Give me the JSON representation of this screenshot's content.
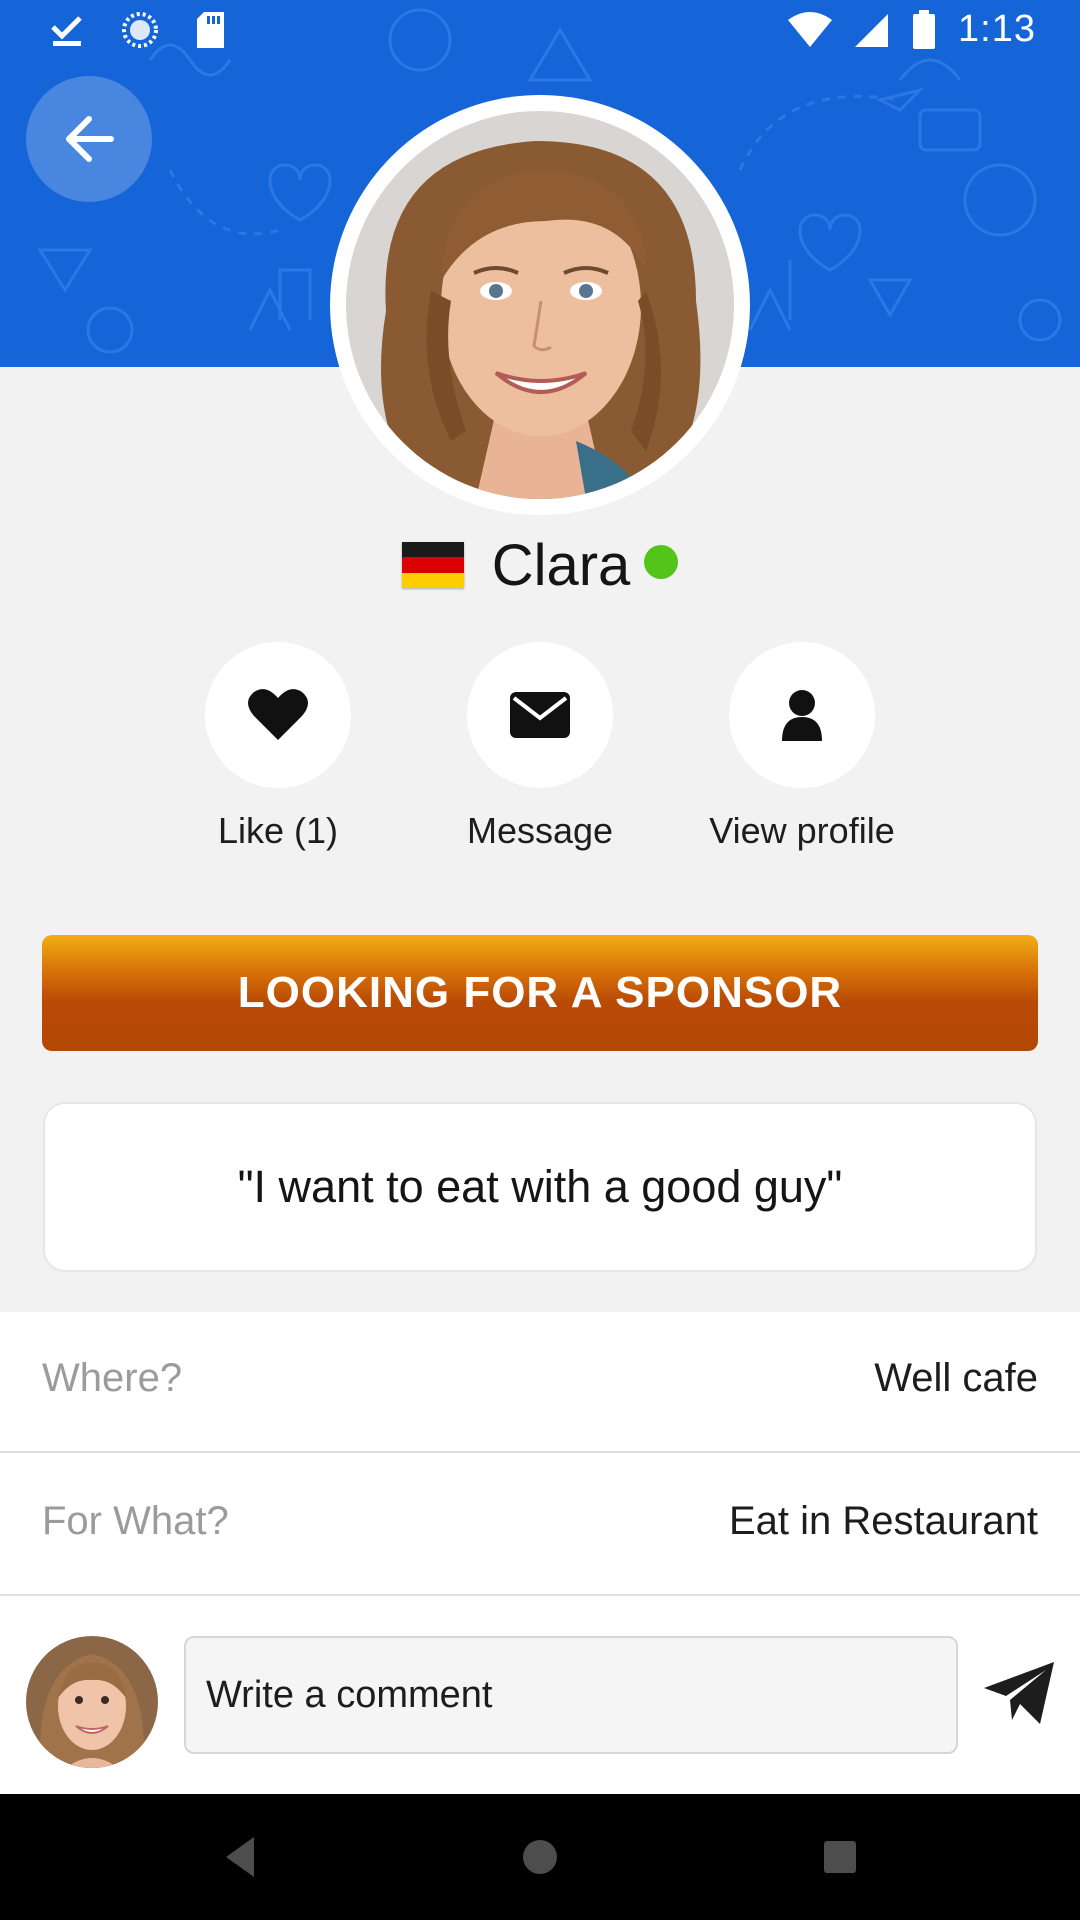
{
  "status_bar": {
    "time": "1:13",
    "icons": [
      "check-download-icon",
      "sync-circle-icon",
      "sd-card-icon",
      "wifi-icon",
      "signal-icon",
      "battery-icon"
    ]
  },
  "header": {
    "back_icon": "arrow-left-icon",
    "background_color": "#1565d8"
  },
  "profile": {
    "name": "Clara",
    "country_flag": "germany-flag-icon",
    "online_color": "#52c41a"
  },
  "actions": [
    {
      "label": "Like (1)",
      "icon": "heart-icon"
    },
    {
      "label": "Message",
      "icon": "envelope-icon"
    },
    {
      "label": "View profile",
      "icon": "user-icon"
    }
  ],
  "sponsor_button": {
    "label": "LOOKING FOR A SPONSOR",
    "color": "#b84a05"
  },
  "quote": "\"I want to eat with a good guy\"",
  "details": [
    {
      "key": "Where?",
      "value": "Well cafe"
    },
    {
      "key": "For What?",
      "value": "Eat in Restaurant"
    }
  ],
  "comment": {
    "placeholder": "Write a comment",
    "send_icon": "paper-plane-icon"
  },
  "navbar": {
    "icons": [
      "nav-back-icon",
      "nav-home-icon",
      "nav-recents-icon"
    ]
  }
}
